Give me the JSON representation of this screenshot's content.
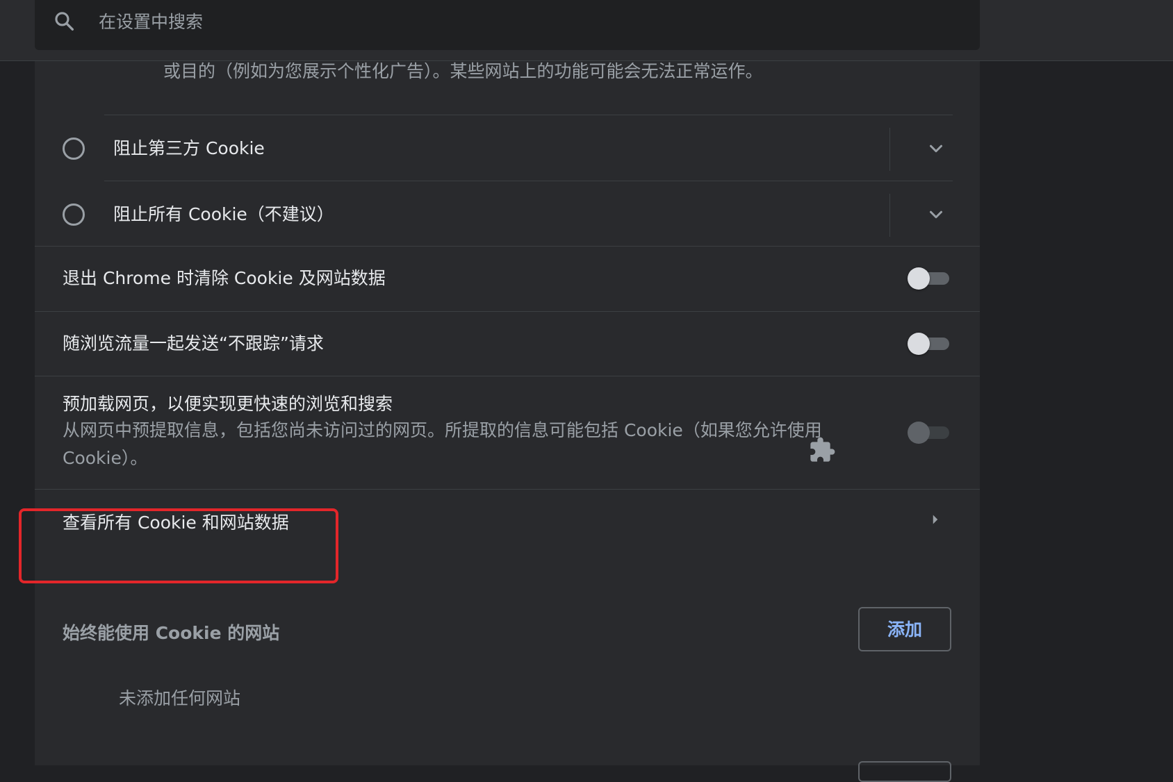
{
  "search": {
    "placeholder": "在设置中搜索"
  },
  "partial_row": {
    "text": "或目的（例如为您展示个性化广告）。某些网站上的功能可能会无法正常运作。"
  },
  "cookie_options": [
    {
      "label": "阻止第三方 Cookie",
      "selected": false
    },
    {
      "label": "阻止所有 Cookie（不建议）",
      "selected": false
    }
  ],
  "toggles": {
    "clear_on_exit": {
      "label": "退出 Chrome 时清除 Cookie 及网站数据",
      "on": false
    },
    "do_not_track": {
      "label": "随浏览流量一起发送“不跟踪”请求",
      "on": false
    },
    "preload": {
      "label": "预加载网页，以便实现更快速的浏览和搜索",
      "sublabel": "从网页中预提取信息，包括您尚未访问过的网页。所提取的信息可能包括 Cookie（如果您允许使用 Cookie）。",
      "on": false,
      "disabled": true
    }
  },
  "view_all": {
    "label": "查看所有 Cookie 和网站数据"
  },
  "always_allow": {
    "title": "始终能使用 Cookie 的网站",
    "add_label": "添加",
    "empty_text": "未添加任何网站"
  },
  "colors": {
    "background": "#202124",
    "card": "#292a2d",
    "accent": "#8ab4f8",
    "highlight": "#e3262a"
  }
}
